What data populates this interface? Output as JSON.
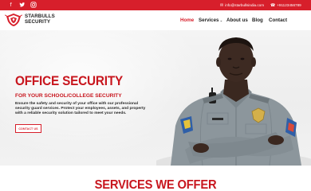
{
  "topbar": {
    "social": [
      {
        "name": "facebook-icon",
        "glyph": "f"
      },
      {
        "name": "twitter-icon",
        "glyph": "t"
      },
      {
        "name": "instagram-icon",
        "glyph": "◎"
      }
    ],
    "email": "info@starbullsindia.com",
    "phone": "+91123456789"
  },
  "logo": {
    "line1": "STARBULLS",
    "line2": "SECURITY"
  },
  "nav": {
    "home": "Home",
    "services": "Services",
    "about": "About us",
    "blog": "Blog",
    "contact": "Contact"
  },
  "hero": {
    "title": "OFFICE SECURITY",
    "subtitle": "FOR YOUR SCHOOL/COLLEGE SECURITY",
    "description": "Ensure the safety and security of your office with our professional security guard services. Protect your employees, assets, and property with a reliable security solution tailored to meet your needs.",
    "cta": "CONTACT US"
  },
  "services": {
    "title": "SERVICES WE OFFER"
  },
  "colors": {
    "brand": "#d71f2b",
    "heading": "#c8161e"
  }
}
